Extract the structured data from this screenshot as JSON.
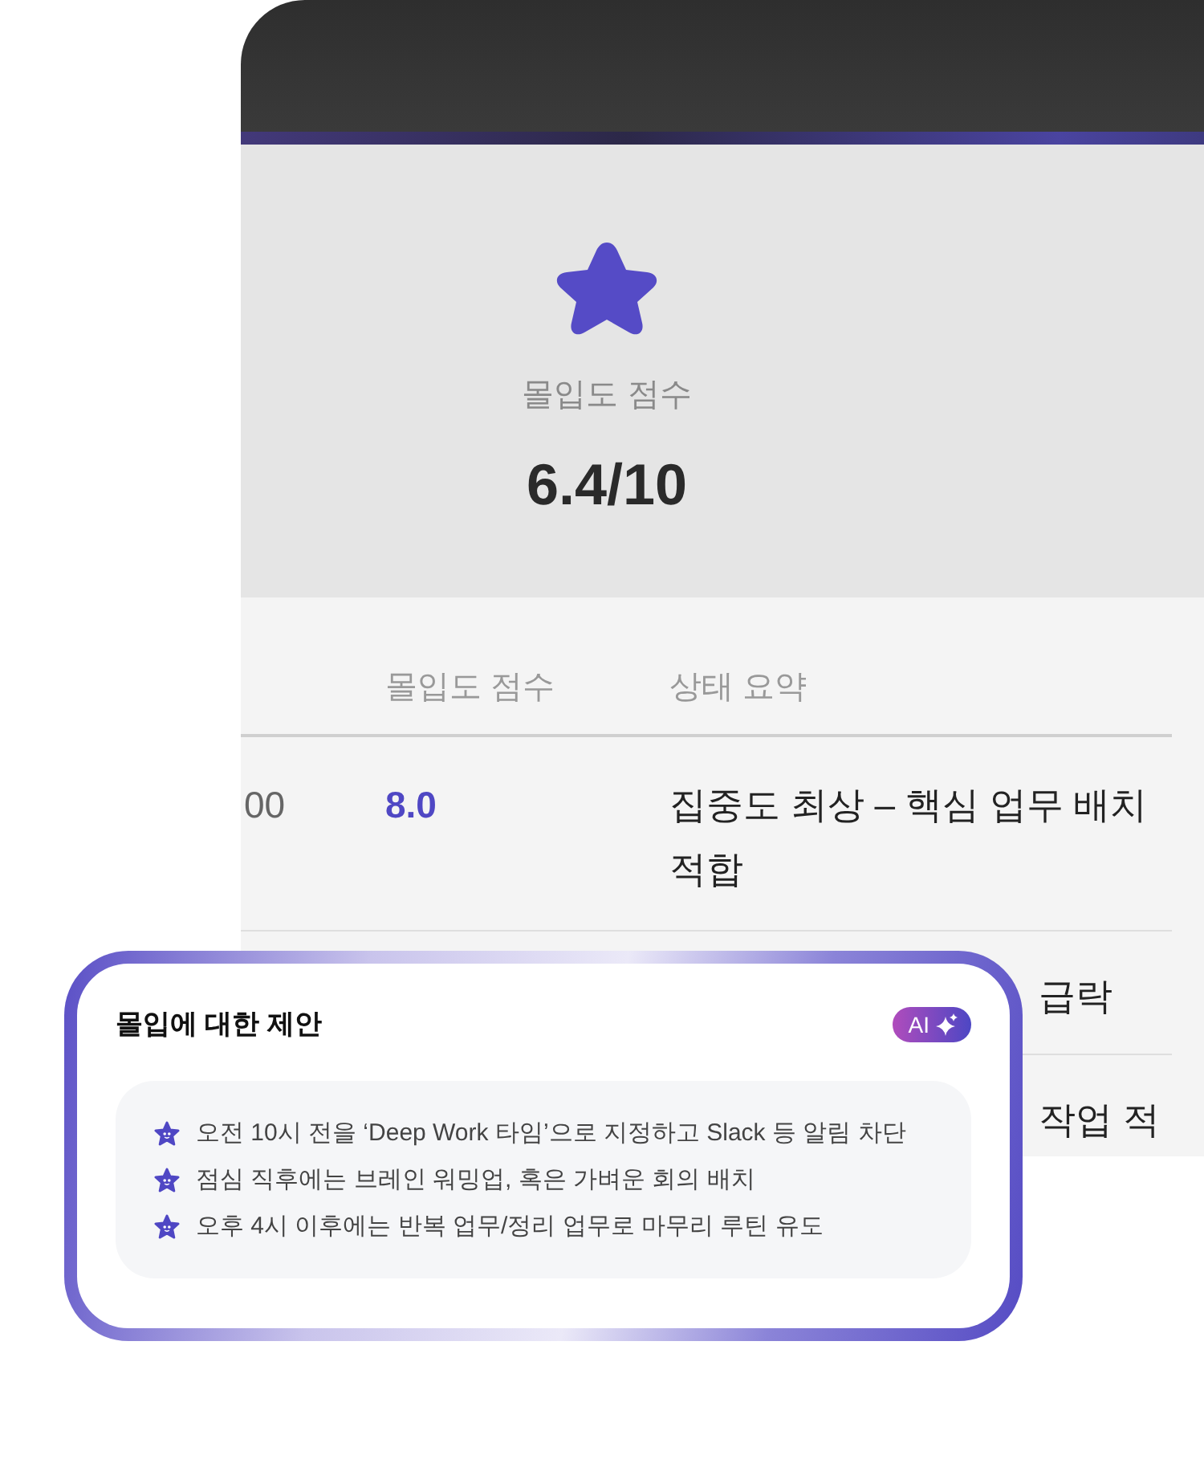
{
  "hero": {
    "label": "몰입도 점수",
    "score": "6.4/10"
  },
  "table": {
    "columns": [
      "몰입도 점수",
      "상태 요약"
    ],
    "rows": [
      {
        "kind": "full",
        "time": "00",
        "score": "8.0",
        "status": "집중도 최상 – 핵심 업무 배치 적합"
      },
      {
        "kind": "covered",
        "status": "급락"
      },
      {
        "kind": "covered",
        "status": "작업 적"
      }
    ]
  },
  "suggestions": {
    "title": "몰입에 대한 제안",
    "badge": "AI",
    "items": [
      "오전 10시 전을 ‘Deep Work 타임’으로 지정하고 Slack 등 알림 차단",
      "점심 직후에는 브레인 워밍업, 혹은 가벼운 회의 배치",
      "오후 4시 이후에는 반복 업무/정리 업무로 마무리 루틴 유도"
    ]
  }
}
